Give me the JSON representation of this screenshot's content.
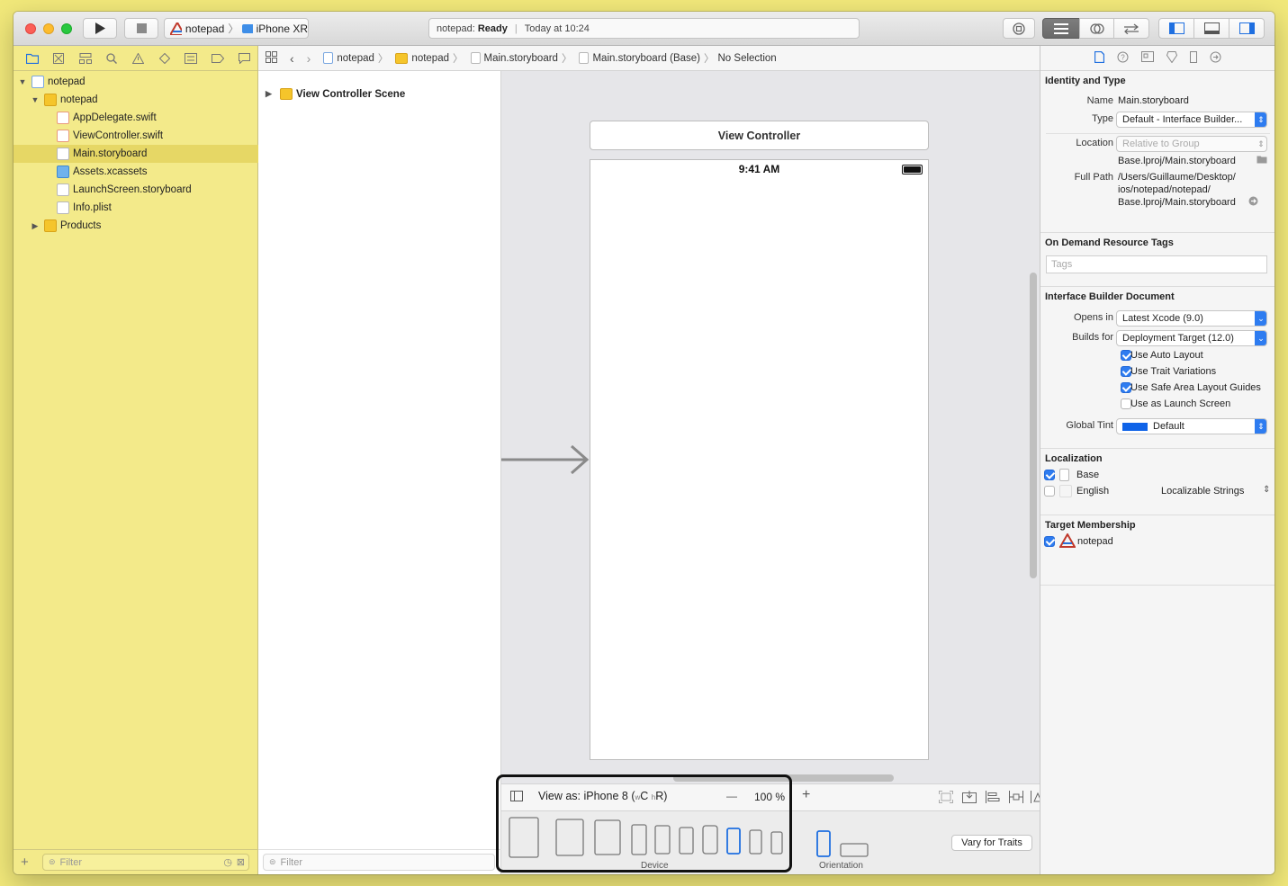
{
  "toolbar": {
    "scheme_name": "notepad",
    "device_name": "iPhone XR",
    "status_project": "notepad:",
    "status_state": "Ready",
    "status_time": "Today at 10:24"
  },
  "navigator": {
    "items": [
      {
        "label": "notepad"
      },
      {
        "label": "notepad"
      },
      {
        "label": "AppDelegate.swift"
      },
      {
        "label": "ViewController.swift"
      },
      {
        "label": "Main.storyboard"
      },
      {
        "label": "Assets.xcassets"
      },
      {
        "label": "LaunchScreen.storyboard"
      },
      {
        "label": "Info.plist"
      },
      {
        "label": "Products"
      }
    ],
    "filter_placeholder": "Filter"
  },
  "jumpbar": {
    "crumbs": [
      "notepad",
      "notepad",
      "Main.storyboard",
      "Main.storyboard (Base)",
      "No Selection"
    ]
  },
  "outline": {
    "scene_label": "View Controller Scene",
    "filter_placeholder": "Filter"
  },
  "canvas": {
    "vc_title": "View Controller",
    "status_time": "9:41 AM"
  },
  "bottombar": {
    "view_as": "View as: iPhone 8",
    "size_class_w": "w",
    "size_class_w_val": "C",
    "size_class_h": "h",
    "size_class_h_val": "R",
    "zoom_minus": "—",
    "zoom": "100 %",
    "zoom_plus": "+"
  },
  "devicebar": {
    "device_label": "Device",
    "orientation_label": "Orientation",
    "vary_button": "Vary for Traits"
  },
  "inspector": {
    "identity": {
      "title": "Identity and Type",
      "name_label": "Name",
      "name_value": "Main.storyboard",
      "type_label": "Type",
      "type_value": "Default - Interface Builder...",
      "location_label": "Location",
      "location_value": "Relative to Group",
      "location_path": "Base.lproj/Main.storyboard",
      "fullpath_label": "Full Path",
      "fullpath_1": "/Users/Guillaume/Desktop/",
      "fullpath_2": "ios/notepad/notepad/",
      "fullpath_3": "Base.lproj/Main.storyboard"
    },
    "tags": {
      "title": "On Demand Resource Tags",
      "placeholder": "Tags"
    },
    "ib_doc": {
      "title": "Interface Builder Document",
      "opens_label": "Opens in",
      "opens_value": "Latest Xcode (9.0)",
      "builds_label": "Builds for",
      "builds_value": "Deployment Target (12.0)",
      "auto_layout": "Use Auto Layout",
      "trait_variations": "Use Trait Variations",
      "safe_area": "Use Safe Area Layout Guides",
      "launch_screen": "Use as Launch Screen",
      "tint_label": "Global Tint",
      "tint_value": "Default",
      "tint_color": "#0f63e8"
    },
    "localization": {
      "title": "Localization",
      "base": "Base",
      "english": "English",
      "english_type": "Localizable Strings"
    },
    "membership": {
      "title": "Target Membership",
      "target": "notepad"
    }
  }
}
